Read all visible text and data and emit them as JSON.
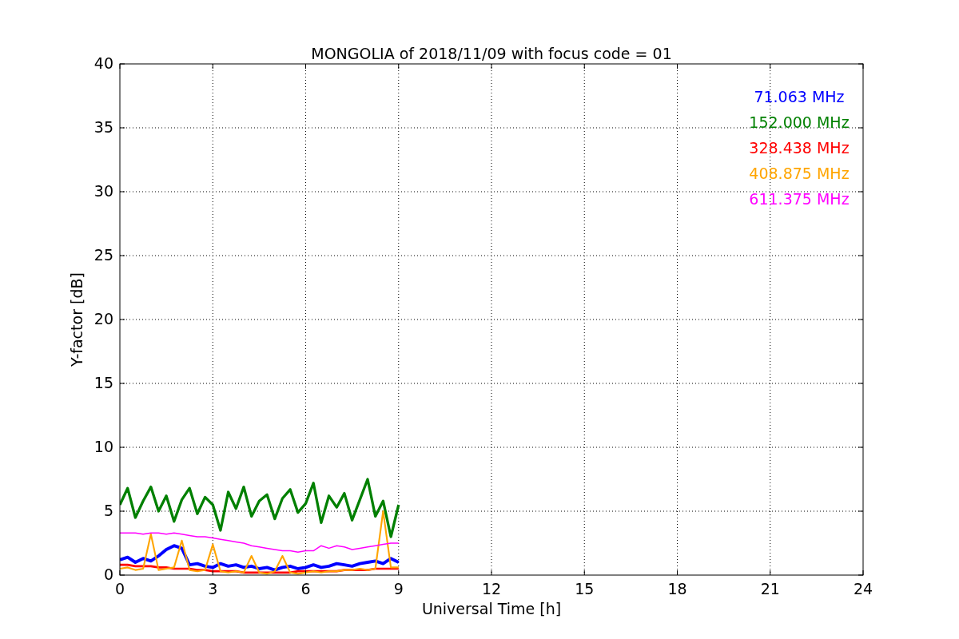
{
  "chart_data": {
    "type": "line",
    "title": "MONGOLIA of 2018/11/09 with focus code = 01",
    "xlabel": "Universal Time [h]",
    "ylabel": "Y-factor [dB]",
    "x": [
      0,
      0.25,
      0.5,
      0.75,
      1,
      1.25,
      1.5,
      1.75,
      2,
      2.25,
      2.5,
      2.75,
      3,
      3.25,
      3.5,
      3.75,
      4,
      4.25,
      4.5,
      4.75,
      5,
      5.25,
      5.5,
      5.75,
      6,
      6.25,
      6.5,
      6.75,
      7,
      7.25,
      7.5,
      7.75,
      8,
      8.25,
      8.5,
      8.75,
      9
    ],
    "series": [
      {
        "name": "71.063 MHz",
        "color": "#0000ff",
        "values": [
          1.2,
          1.4,
          1.0,
          1.3,
          1.1,
          1.5,
          2.0,
          2.3,
          2.1,
          0.8,
          0.9,
          0.7,
          0.6,
          0.9,
          0.7,
          0.8,
          0.6,
          0.7,
          0.5,
          0.6,
          0.4,
          0.6,
          0.7,
          0.5,
          0.6,
          0.8,
          0.6,
          0.7,
          0.9,
          0.8,
          0.7,
          0.9,
          1.0,
          1.1,
          0.9,
          1.3,
          1.0
        ]
      },
      {
        "name": "152.000 MHz",
        "color": "#008000",
        "values": [
          5.5,
          6.8,
          4.5,
          5.8,
          6.9,
          5.0,
          6.2,
          4.2,
          5.9,
          6.8,
          4.8,
          6.1,
          5.5,
          3.5,
          6.5,
          5.2,
          6.9,
          4.6,
          5.8,
          6.3,
          4.4,
          6.0,
          6.7,
          4.9,
          5.6,
          7.2,
          4.1,
          6.2,
          5.3,
          6.4,
          4.3,
          5.9,
          7.5,
          4.6,
          5.8,
          3.0,
          5.5
        ]
      },
      {
        "name": "328.438 MHz",
        "color": "#ff0000",
        "values": [
          0.8,
          0.8,
          0.7,
          0.7,
          0.7,
          0.6,
          0.6,
          0.5,
          0.5,
          0.5,
          0.4,
          0.4,
          0.3,
          0.3,
          0.3,
          0.3,
          0.2,
          0.2,
          0.2,
          0.2,
          0.2,
          0.2,
          0.2,
          0.3,
          0.3,
          0.3,
          0.3,
          0.3,
          0.3,
          0.4,
          0.4,
          0.4,
          0.4,
          0.5,
          0.5,
          0.5,
          0.5
        ]
      },
      {
        "name": "408.875 MHz",
        "color": "#ffa500",
        "values": [
          0.5,
          0.6,
          0.4,
          0.5,
          3.2,
          0.4,
          0.5,
          0.6,
          2.7,
          0.4,
          0.3,
          0.4,
          2.4,
          0.3,
          0.2,
          0.3,
          0.2,
          1.5,
          0.2,
          0.1,
          0.3,
          1.5,
          0.2,
          0.1,
          0.2,
          0.3,
          0.2,
          0.3,
          0.3,
          0.4,
          0.4,
          0.5,
          0.4,
          0.5,
          5.0,
          0.6,
          0.6
        ]
      },
      {
        "name": "611.375 MHz",
        "color": "#ff00ff",
        "values": [
          3.3,
          3.3,
          3.3,
          3.2,
          3.3,
          3.3,
          3.2,
          3.3,
          3.2,
          3.1,
          3.0,
          3.0,
          2.9,
          2.8,
          2.7,
          2.6,
          2.5,
          2.3,
          2.2,
          2.1,
          2.0,
          1.9,
          1.9,
          1.8,
          1.9,
          1.9,
          2.3,
          2.1,
          2.3,
          2.2,
          2.0,
          2.1,
          2.2,
          2.3,
          2.4,
          2.5,
          2.5
        ]
      }
    ],
    "xlim": [
      0,
      24
    ],
    "ylim": [
      0,
      40
    ],
    "xticks": [
      0,
      3,
      6,
      9,
      12,
      15,
      18,
      21,
      24
    ],
    "yticks": [
      0,
      5,
      10,
      15,
      20,
      25,
      30,
      35,
      40
    ],
    "grid": true
  }
}
